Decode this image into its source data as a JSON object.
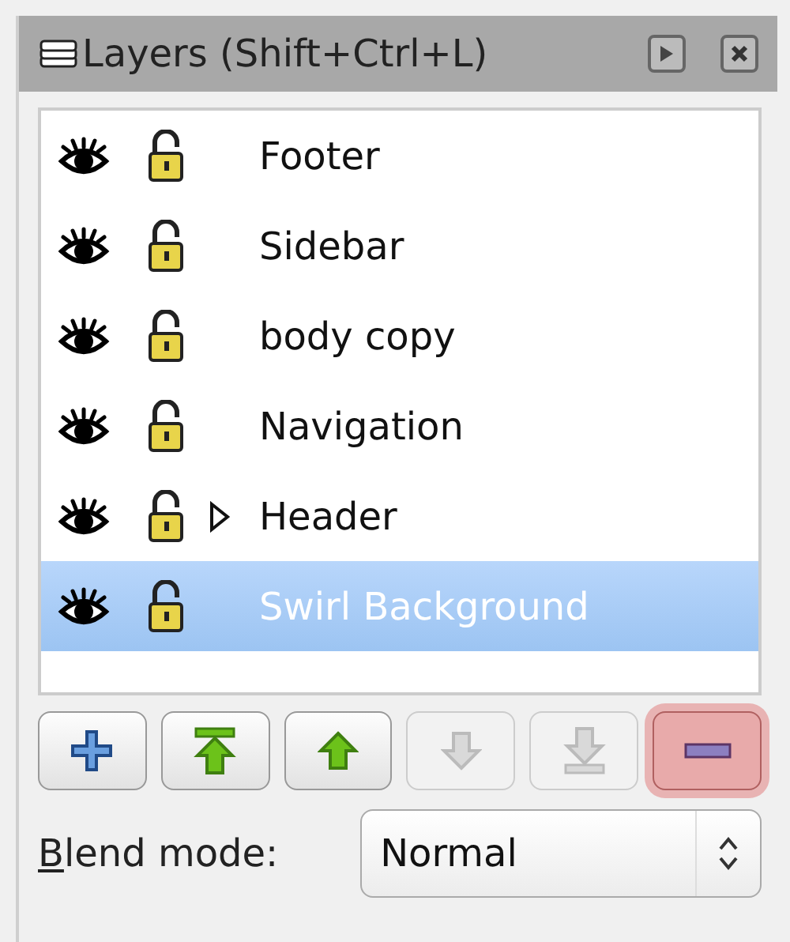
{
  "panel": {
    "title": "Layers (Shift+Ctrl+L)"
  },
  "layers": [
    {
      "name": "Footer",
      "visible": true,
      "locked": false,
      "expandable": false,
      "selected": false
    },
    {
      "name": "Sidebar",
      "visible": true,
      "locked": false,
      "expandable": false,
      "selected": false
    },
    {
      "name": "body copy",
      "visible": true,
      "locked": false,
      "expandable": false,
      "selected": false
    },
    {
      "name": "Navigation",
      "visible": true,
      "locked": false,
      "expandable": false,
      "selected": false
    },
    {
      "name": "Header",
      "visible": true,
      "locked": false,
      "expandable": true,
      "selected": false
    },
    {
      "name": "Swirl Background",
      "visible": true,
      "locked": false,
      "expandable": false,
      "selected": true
    }
  ],
  "buttons": [
    {
      "kind": "add",
      "disabled": false,
      "highlighted": false
    },
    {
      "kind": "top",
      "disabled": false,
      "highlighted": false
    },
    {
      "kind": "up",
      "disabled": false,
      "highlighted": false
    },
    {
      "kind": "down",
      "disabled": true,
      "highlighted": false
    },
    {
      "kind": "bottom",
      "disabled": true,
      "highlighted": false
    },
    {
      "kind": "remove",
      "disabled": false,
      "highlighted": true
    }
  ],
  "blend_mode": {
    "label_mnemonic": "B",
    "label_rest": "lend mode:",
    "value": "Normal"
  }
}
